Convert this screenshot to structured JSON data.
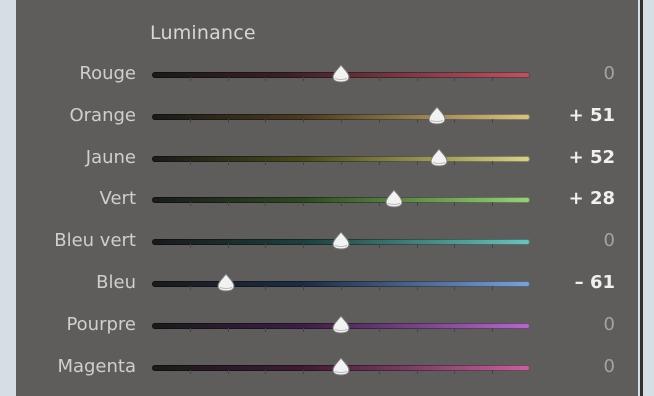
{
  "panel": {
    "title": "Luminance",
    "colors": {
      "background": "#5f5d5c",
      "label": "#cfcfcf",
      "value_active": "#f0f0f0",
      "value_zero": "#a3a3a3"
    },
    "sliders": [
      {
        "label": "Rouge",
        "value": "0",
        "num": 0,
        "track": "linear-gradient(90deg,#1a1a1a 0%,#3a2025 35%,#b85565 100%)"
      },
      {
        "label": "Orange",
        "value": "+ 51",
        "num": 51,
        "track": "linear-gradient(90deg,#1a1a1a 0%,#4a3a20 40%,#d9c38a 100%)"
      },
      {
        "label": "Jaune",
        "value": "+ 52",
        "num": 52,
        "track": "linear-gradient(90deg,#1a1a1a 0%,#4a4a20 40%,#d7d28f 100%)"
      },
      {
        "label": "Vert",
        "value": "+ 28",
        "num": 28,
        "track": "linear-gradient(90deg,#1a1a1a 0%,#2f4a23 40%,#9bd07e 100%)"
      },
      {
        "label": "Bleu vert",
        "value": "0",
        "num": 0,
        "track": "linear-gradient(90deg,#1a1a1a 0%,#1e3f3d 40%,#6ec2bb 100%)"
      },
      {
        "label": "Bleu",
        "value": "– 61",
        "num": -61,
        "track": "linear-gradient(90deg,#1a1a1a 0%,#1d2c45 40%,#7da1d4 100%)"
      },
      {
        "label": "Pourpre",
        "value": "0",
        "num": 0,
        "track": "linear-gradient(90deg,#1a1a1a 0%,#3b1e45 40%,#b26bc7 100%)"
      },
      {
        "label": "Magenta",
        "value": "0",
        "num": 0,
        "track": "linear-gradient(90deg,#1a1a1a 0%,#3e1b33 40%,#c2649b 100%)"
      }
    ]
  }
}
